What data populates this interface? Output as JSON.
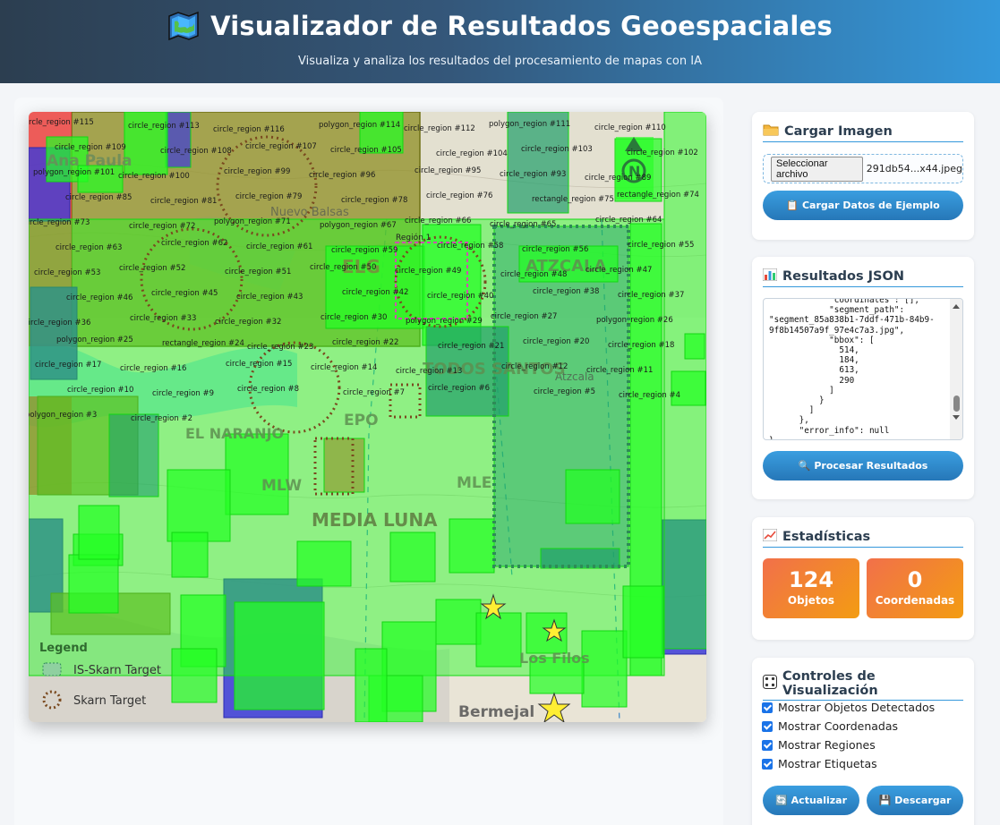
{
  "header": {
    "title": "Visualizador de Resultados Geoespaciales",
    "subtitle": "Visualiza y analiza los resultados del procesamiento de mapas con IA",
    "icon": "world-map-icon"
  },
  "map": {
    "place_labels": [
      "Ana Paula",
      "Nuevo Balsas",
      "ELG",
      "ATZCALA",
      "Atzcala",
      "TODOS SANTOS",
      "EL NARANJO",
      "EPO",
      "MLW",
      "MLE",
      "MEDIA LUNA",
      "Los Filos",
      "Bermejal"
    ],
    "legend_title": "Legend",
    "legend_items": [
      "IS-Skarn Target",
      "Skarn Target"
    ],
    "highlight_label": "Región 1",
    "detections": [
      "circle_region #115",
      "circle_region #113",
      "circle_region #116",
      "polygon_region #114",
      "circle_region #112",
      "polygon_region #111",
      "circle_region #110",
      "circle_region #109",
      "circle_region #108",
      "circle_region #107",
      "circle_region #105",
      "circle_region #104",
      "circle_region #103",
      "circle_region #102",
      "polygon_region #101",
      "circle_region #100",
      "circle_region #99",
      "circle_region #96",
      "circle_region #95",
      "circle_region #93",
      "circle_region #89",
      "circle_region #85",
      "circle_region #81",
      "circle_region #79",
      "circle_region #78",
      "circle_region #76",
      "rectangle_region #75",
      "rectangle_region #74",
      "circle_region #73",
      "circle_region #72",
      "polygon_region #71",
      "polygon_region #67",
      "circle_region #66",
      "circle_region #65",
      "circle_region #64",
      "circle_region #63",
      "circle_region #62",
      "circle_region #61",
      "circle_region #59",
      "circle_region #58",
      "circle_region #56",
      "circle_region #55",
      "circle_region #53",
      "circle_region #52",
      "circle_region #51",
      "circle_region #50",
      "circle_region #49",
      "circle_region #48",
      "circle_region #47",
      "circle_region #46",
      "circle_region #45",
      "circle_region #43",
      "circle_region #42",
      "circle_region #40",
      "circle_region #38",
      "circle_region #37",
      "circle_region #36",
      "circle_region #33",
      "circle_region #32",
      "circle_region #30",
      "polygon_region #29",
      "circle_region #27",
      "polygon_region #26",
      "polygon_region #25",
      "rectangle_region #24",
      "circle_region #23",
      "circle_region #22",
      "circle_region #21",
      "circle_region #20",
      "circle_region #18",
      "circle_region #17",
      "circle_region #16",
      "circle_region #15",
      "circle_region #14",
      "circle_region #13",
      "circle_region #12",
      "circle_region #11",
      "circle_region #10",
      "circle_region #9",
      "circle_region #8",
      "circle_region #7",
      "circle_region #6",
      "circle_region #5",
      "circle_region #4",
      "polygon_region #3",
      "circle_region #2"
    ]
  },
  "upload": {
    "title": "Cargar Imagen",
    "file_button": "Seleccionar archivo",
    "file_name": "291db54...x44.jpeg",
    "sample_button": "Cargar Datos de Ejemplo"
  },
  "json_panel": {
    "title": "Resultados JSON",
    "content": "            \"coordinates\": [],\n            \"segment_path\":\n\"segment_85a838b1-7ddf-471b-84b9-\n9f8b14507a9f_97e4c7a3.jpg\",\n            \"bbox\": [\n              514,\n              184,\n              613,\n              290\n            ]\n          }\n        ]\n      },\n      \"error_info\": null\n}",
    "process_button": "Procesar Resultados"
  },
  "stats": {
    "title": "Estadísticas",
    "objects_value": "124",
    "objects_label": "Objetos",
    "coords_value": "0",
    "coords_label": "Coordenadas"
  },
  "controls": {
    "title": "Controles de Visualización",
    "options": [
      "Mostrar Objetos Detectados",
      "Mostrar Coordenadas",
      "Mostrar Regiones",
      "Mostrar Etiquetas"
    ],
    "update_button": "Actualizar",
    "download_button": "Descargar"
  },
  "colors": {
    "detection_green": "#22ff22",
    "region_olive": "#8a8a1e",
    "region_blue": "#3b3bd8",
    "region_red": "#ef3b3b",
    "accent": "#3498db"
  }
}
